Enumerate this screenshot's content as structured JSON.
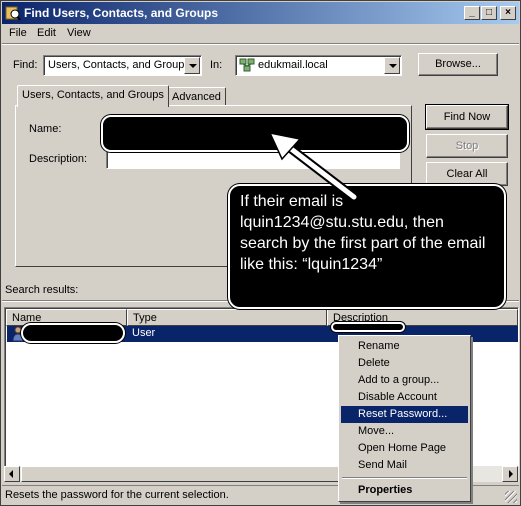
{
  "window": {
    "title": "Find Users, Contacts, and Groups",
    "controls": {
      "minimize": "_",
      "maximize": "□",
      "close": "×"
    }
  },
  "menu": [
    "File",
    "Edit",
    "View"
  ],
  "find_row": {
    "find_label": "Find:",
    "find_value": "Users, Contacts, and Groups",
    "in_label": "In:",
    "in_value": "edukmail.local",
    "browse_button": "Browse..."
  },
  "tabs": [
    "Users, Contacts, and Groups",
    "Advanced"
  ],
  "form": {
    "name_label": "Name:",
    "description_label": "Description:"
  },
  "buttons": {
    "find_now": "Find Now",
    "stop": "Stop",
    "clear_all": "Clear All"
  },
  "callout": {
    "text": "If their email is lquin1234@stu.stu.edu, then search by the first part of the email like this: “lquin1234”"
  },
  "results": {
    "label": "Search results:",
    "columns": [
      "Name",
      "Type",
      "Description"
    ],
    "rows": [
      {
        "type": "User"
      }
    ]
  },
  "context_menu": {
    "items": [
      "Rename",
      "Delete",
      "Add to a group...",
      "Disable Account",
      "Reset Password...",
      "Move...",
      "Open Home Page",
      "Send Mail"
    ],
    "highlighted": "Reset Password...",
    "properties": "Properties"
  },
  "status": {
    "text": "Resets the password for the current selection."
  },
  "icons": {
    "title": "find-people-icon",
    "domain": "domain-icon",
    "user": "user-icon"
  },
  "colors": {
    "title_bar": "#0a246a",
    "selection": "#0a246a",
    "face": "#d4d0c8"
  }
}
